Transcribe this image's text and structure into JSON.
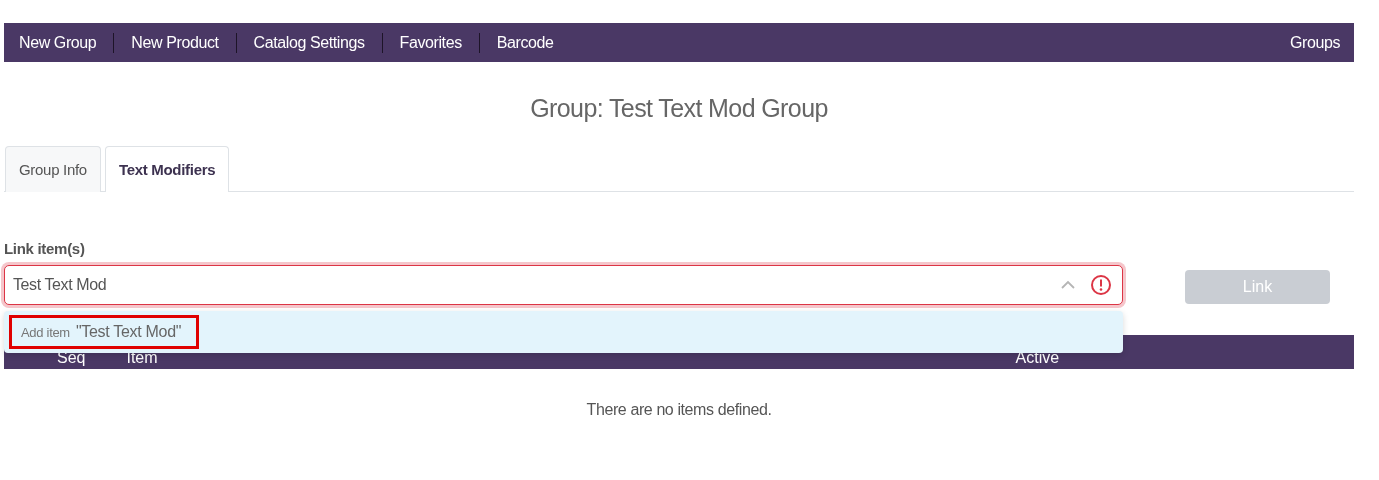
{
  "nav": {
    "items": [
      {
        "label": "New Group"
      },
      {
        "label": "New Product"
      },
      {
        "label": "Catalog Settings"
      },
      {
        "label": "Favorites"
      },
      {
        "label": "Barcode"
      }
    ],
    "right": "Groups"
  },
  "title": "Group: Test Text Mod Group",
  "tabs": [
    {
      "label": "Group Info",
      "selected": false
    },
    {
      "label": "Text Modifiers",
      "selected": true
    }
  ],
  "link_field": {
    "label": "Link item(s)",
    "value": "Test Text Mod",
    "invalid": true,
    "expanded": true
  },
  "link_button": {
    "label": "Link",
    "disabled": true
  },
  "dropdown": {
    "prefix": "Add item",
    "text": "\"Test Text Mod\"",
    "highlighted": true
  },
  "table": {
    "columns": [
      "Seq",
      "Item",
      "Active"
    ],
    "empty": "There are no items defined."
  }
}
